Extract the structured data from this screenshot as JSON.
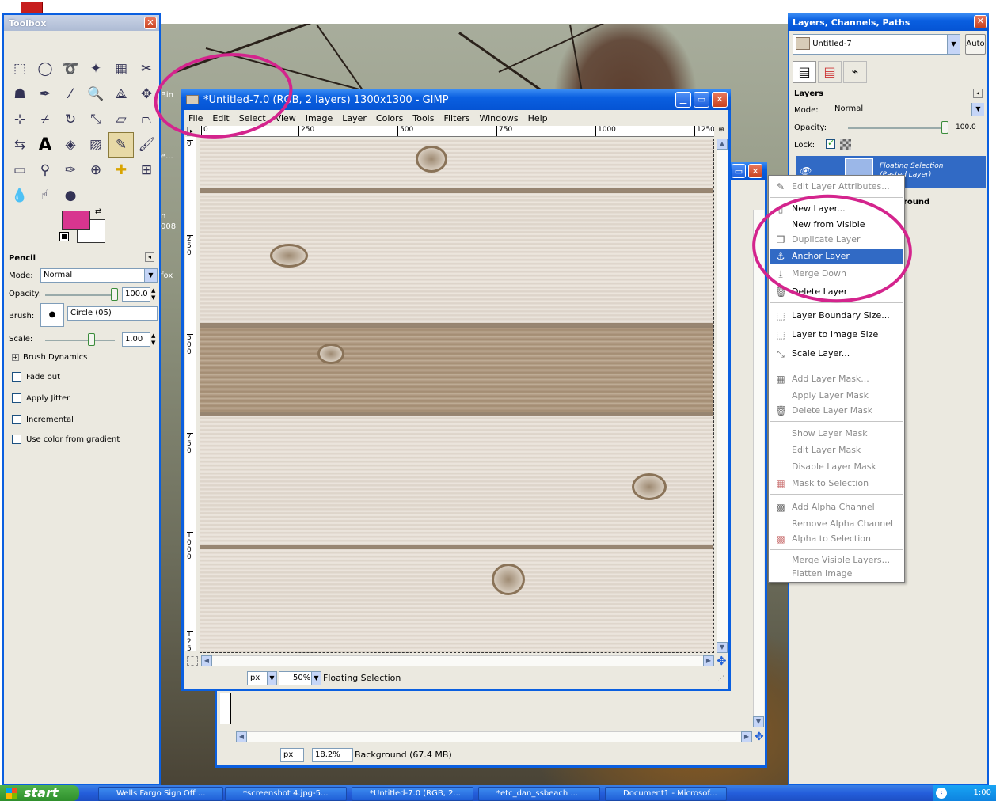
{
  "toolbox": {
    "title": "Toolbox",
    "options_title": "Pencil",
    "mode_label": "Mode:",
    "mode_value": "Normal",
    "opacity_label": "Opacity:",
    "opacity_value": "100.0",
    "brush_label": "Brush:",
    "brush_value": "Circle (05)",
    "scale_label": "Scale:",
    "scale_value": "1.00",
    "brush_dynamics": "Brush Dynamics",
    "options": [
      {
        "label": "Fade out",
        "checked": false
      },
      {
        "label": "Apply Jitter",
        "checked": false
      },
      {
        "label": "Incremental",
        "checked": false
      },
      {
        "label": "Use color from gradient",
        "checked": false
      }
    ],
    "fg_color": "#d8358f",
    "bg_color": "#ffffff"
  },
  "image_front": {
    "title": "*Untitled-7.0 (RGB, 2 layers) 1300x1300 - GIMP",
    "menus": [
      "File",
      "Edit",
      "Select",
      "View",
      "Image",
      "Layer",
      "Colors",
      "Tools",
      "Filters",
      "Windows",
      "Help"
    ],
    "ruler_h": [
      "0",
      "250",
      "500",
      "750",
      "1000",
      "1250"
    ],
    "ruler_v": [
      "0",
      "250",
      "500",
      "750",
      "1000",
      "1250"
    ],
    "unit": "px",
    "zoom": "50%",
    "status": "Floating Selection"
  },
  "image_back": {
    "unit": "px",
    "zoom": "18.2%",
    "status": "Background (67.4 MB)"
  },
  "wallpaper_labels": [
    "Bin",
    "e...",
    "n",
    "008",
    "fox"
  ],
  "dock": {
    "title": "Layers, Channels, Paths",
    "image_select": "Untitled-7",
    "auto_label": "Auto",
    "section_title": "Layers",
    "mode_label": "Mode:",
    "mode_value": "Normal",
    "opacity_label": "Opacity:",
    "opacity_value": "100.0",
    "lock_label": "Lock:",
    "layer_name": "Floating Selection",
    "layer_sub": "(Pasted Layer)",
    "layer_partial": "round"
  },
  "context_menu": {
    "items": [
      {
        "label": "Edit Layer Attributes...",
        "disabled": true,
        "icon": "edit-icon"
      },
      {
        "sep": true
      },
      {
        "label": "New Layer...",
        "disabled": false,
        "icon": "new-layer-icon"
      },
      {
        "label": "New from Visible",
        "disabled": false,
        "icon": ""
      },
      {
        "label": "Duplicate Layer",
        "disabled": true,
        "icon": "duplicate-icon"
      },
      {
        "label": "Anchor Layer",
        "disabled": false,
        "highlighted": true,
        "icon": "anchor-icon"
      },
      {
        "label": "Merge Down",
        "disabled": true,
        "icon": "merge-icon"
      },
      {
        "label": "Delete Layer",
        "disabled": false,
        "icon": "trash-icon"
      },
      {
        "sep": true
      },
      {
        "label": "Layer Boundary Size...",
        "disabled": false,
        "icon": "boundary-icon"
      },
      {
        "label": "Layer to Image Size",
        "disabled": false,
        "icon": "fit-icon"
      },
      {
        "label": "Scale Layer...",
        "disabled": false,
        "icon": "scale-icon"
      },
      {
        "sep": true
      },
      {
        "label": "Add Layer Mask...",
        "disabled": true,
        "icon": "mask-add-icon"
      },
      {
        "label": "Apply Layer Mask",
        "disabled": true,
        "icon": ""
      },
      {
        "label": "Delete Layer Mask",
        "disabled": true,
        "icon": "trash-icon"
      },
      {
        "sep": true
      },
      {
        "label": "Show Layer Mask",
        "disabled": true,
        "icon": ""
      },
      {
        "label": "Edit Layer Mask",
        "disabled": true,
        "icon": ""
      },
      {
        "label": "Disable Layer Mask",
        "disabled": true,
        "icon": ""
      },
      {
        "label": "Mask to Selection",
        "disabled": true,
        "icon": "mask-select-icon"
      },
      {
        "sep": true
      },
      {
        "label": "Add Alpha Channel",
        "disabled": true,
        "icon": "alpha-icon"
      },
      {
        "label": "Remove Alpha Channel",
        "disabled": true,
        "icon": ""
      },
      {
        "label": "Alpha to Selection",
        "disabled": true,
        "icon": "alpha-select-icon"
      },
      {
        "sep": true
      },
      {
        "label": "Merge Visible Layers...",
        "disabled": true,
        "icon": ""
      },
      {
        "label": "Flatten Image",
        "disabled": true,
        "icon": ""
      }
    ]
  },
  "taskbar": {
    "start": "start",
    "tasks": [
      "Wells Fargo Sign Off ...",
      "*screenshot 4.jpg-5...",
      "*Untitled-7.0 (RGB, 2...",
      "*etc_dan_ssbeach ...",
      "Document1 - Microsof..."
    ],
    "clock": "1:00"
  }
}
